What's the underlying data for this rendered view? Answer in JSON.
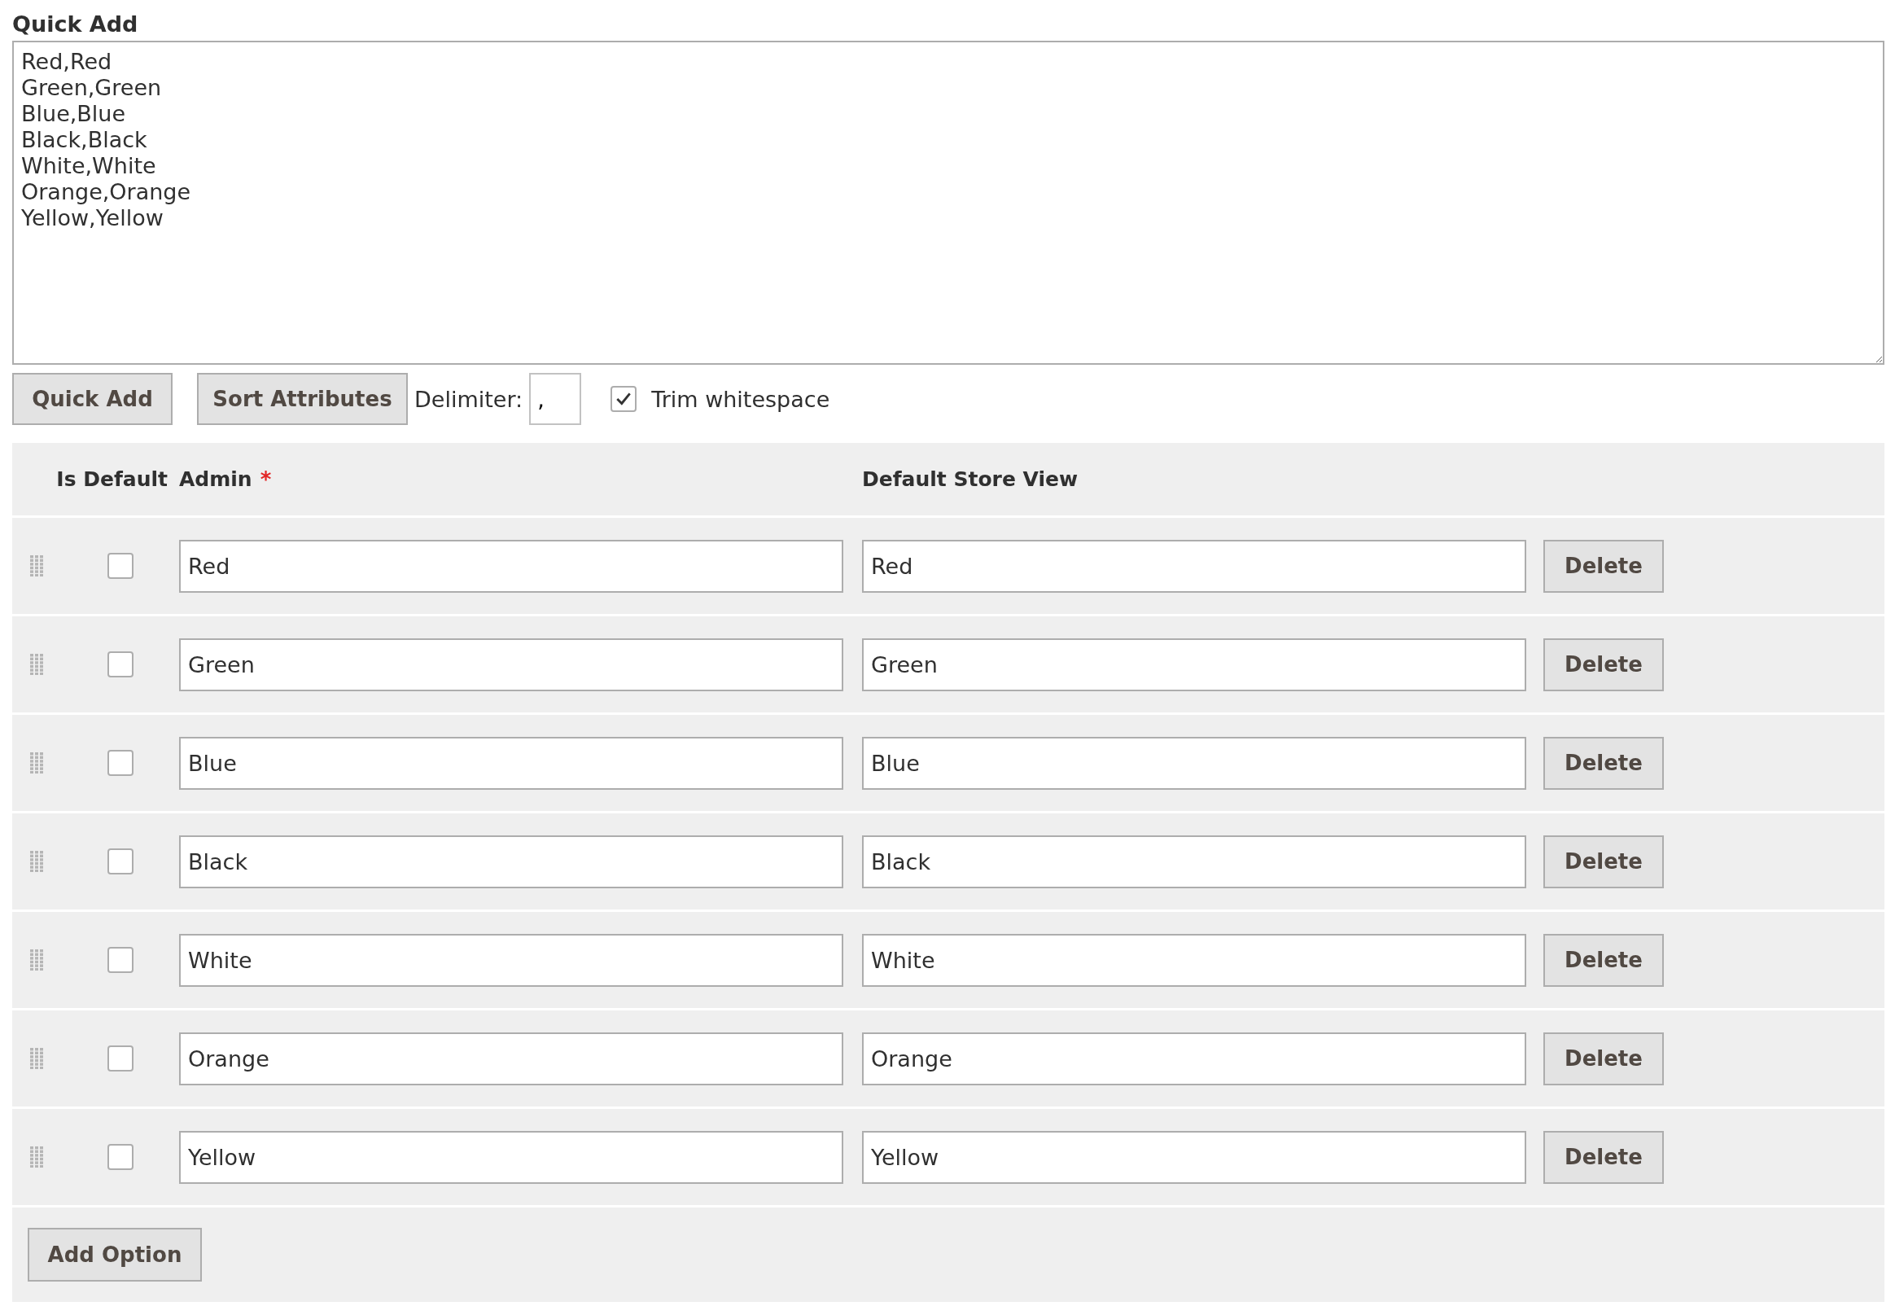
{
  "quick_add": {
    "title": "Quick Add",
    "value": "Red,Red\nGreen,Green\nBlue,Blue\nBlack,Black\nWhite,White\nOrange,Orange\nYellow,Yellow"
  },
  "toolbar": {
    "quick_add_button": "Quick Add",
    "sort_button": "Sort Attributes",
    "delimiter_label": "Delimiter:",
    "delimiter_value": ",",
    "trim_label": "Trim whitespace",
    "trim_checked": true
  },
  "table": {
    "columns": [
      {
        "label": "Is Default"
      },
      {
        "label": "Admin",
        "required_mark": "*"
      },
      {
        "label": "Default Store View"
      }
    ],
    "rows": [
      {
        "is_default": false,
        "admin": "Red",
        "store_view": "Red",
        "delete": "Delete"
      },
      {
        "is_default": false,
        "admin": "Green",
        "store_view": "Green",
        "delete": "Delete"
      },
      {
        "is_default": false,
        "admin": "Blue",
        "store_view": "Blue",
        "delete": "Delete"
      },
      {
        "is_default": false,
        "admin": "Black",
        "store_view": "Black",
        "delete": "Delete"
      },
      {
        "is_default": false,
        "admin": "White",
        "store_view": "White",
        "delete": "Delete"
      },
      {
        "is_default": false,
        "admin": "Orange",
        "store_view": "Orange",
        "delete": "Delete"
      },
      {
        "is_default": false,
        "admin": "Yellow",
        "store_view": "Yellow",
        "delete": "Delete"
      }
    ],
    "add_button": "Add Option"
  }
}
